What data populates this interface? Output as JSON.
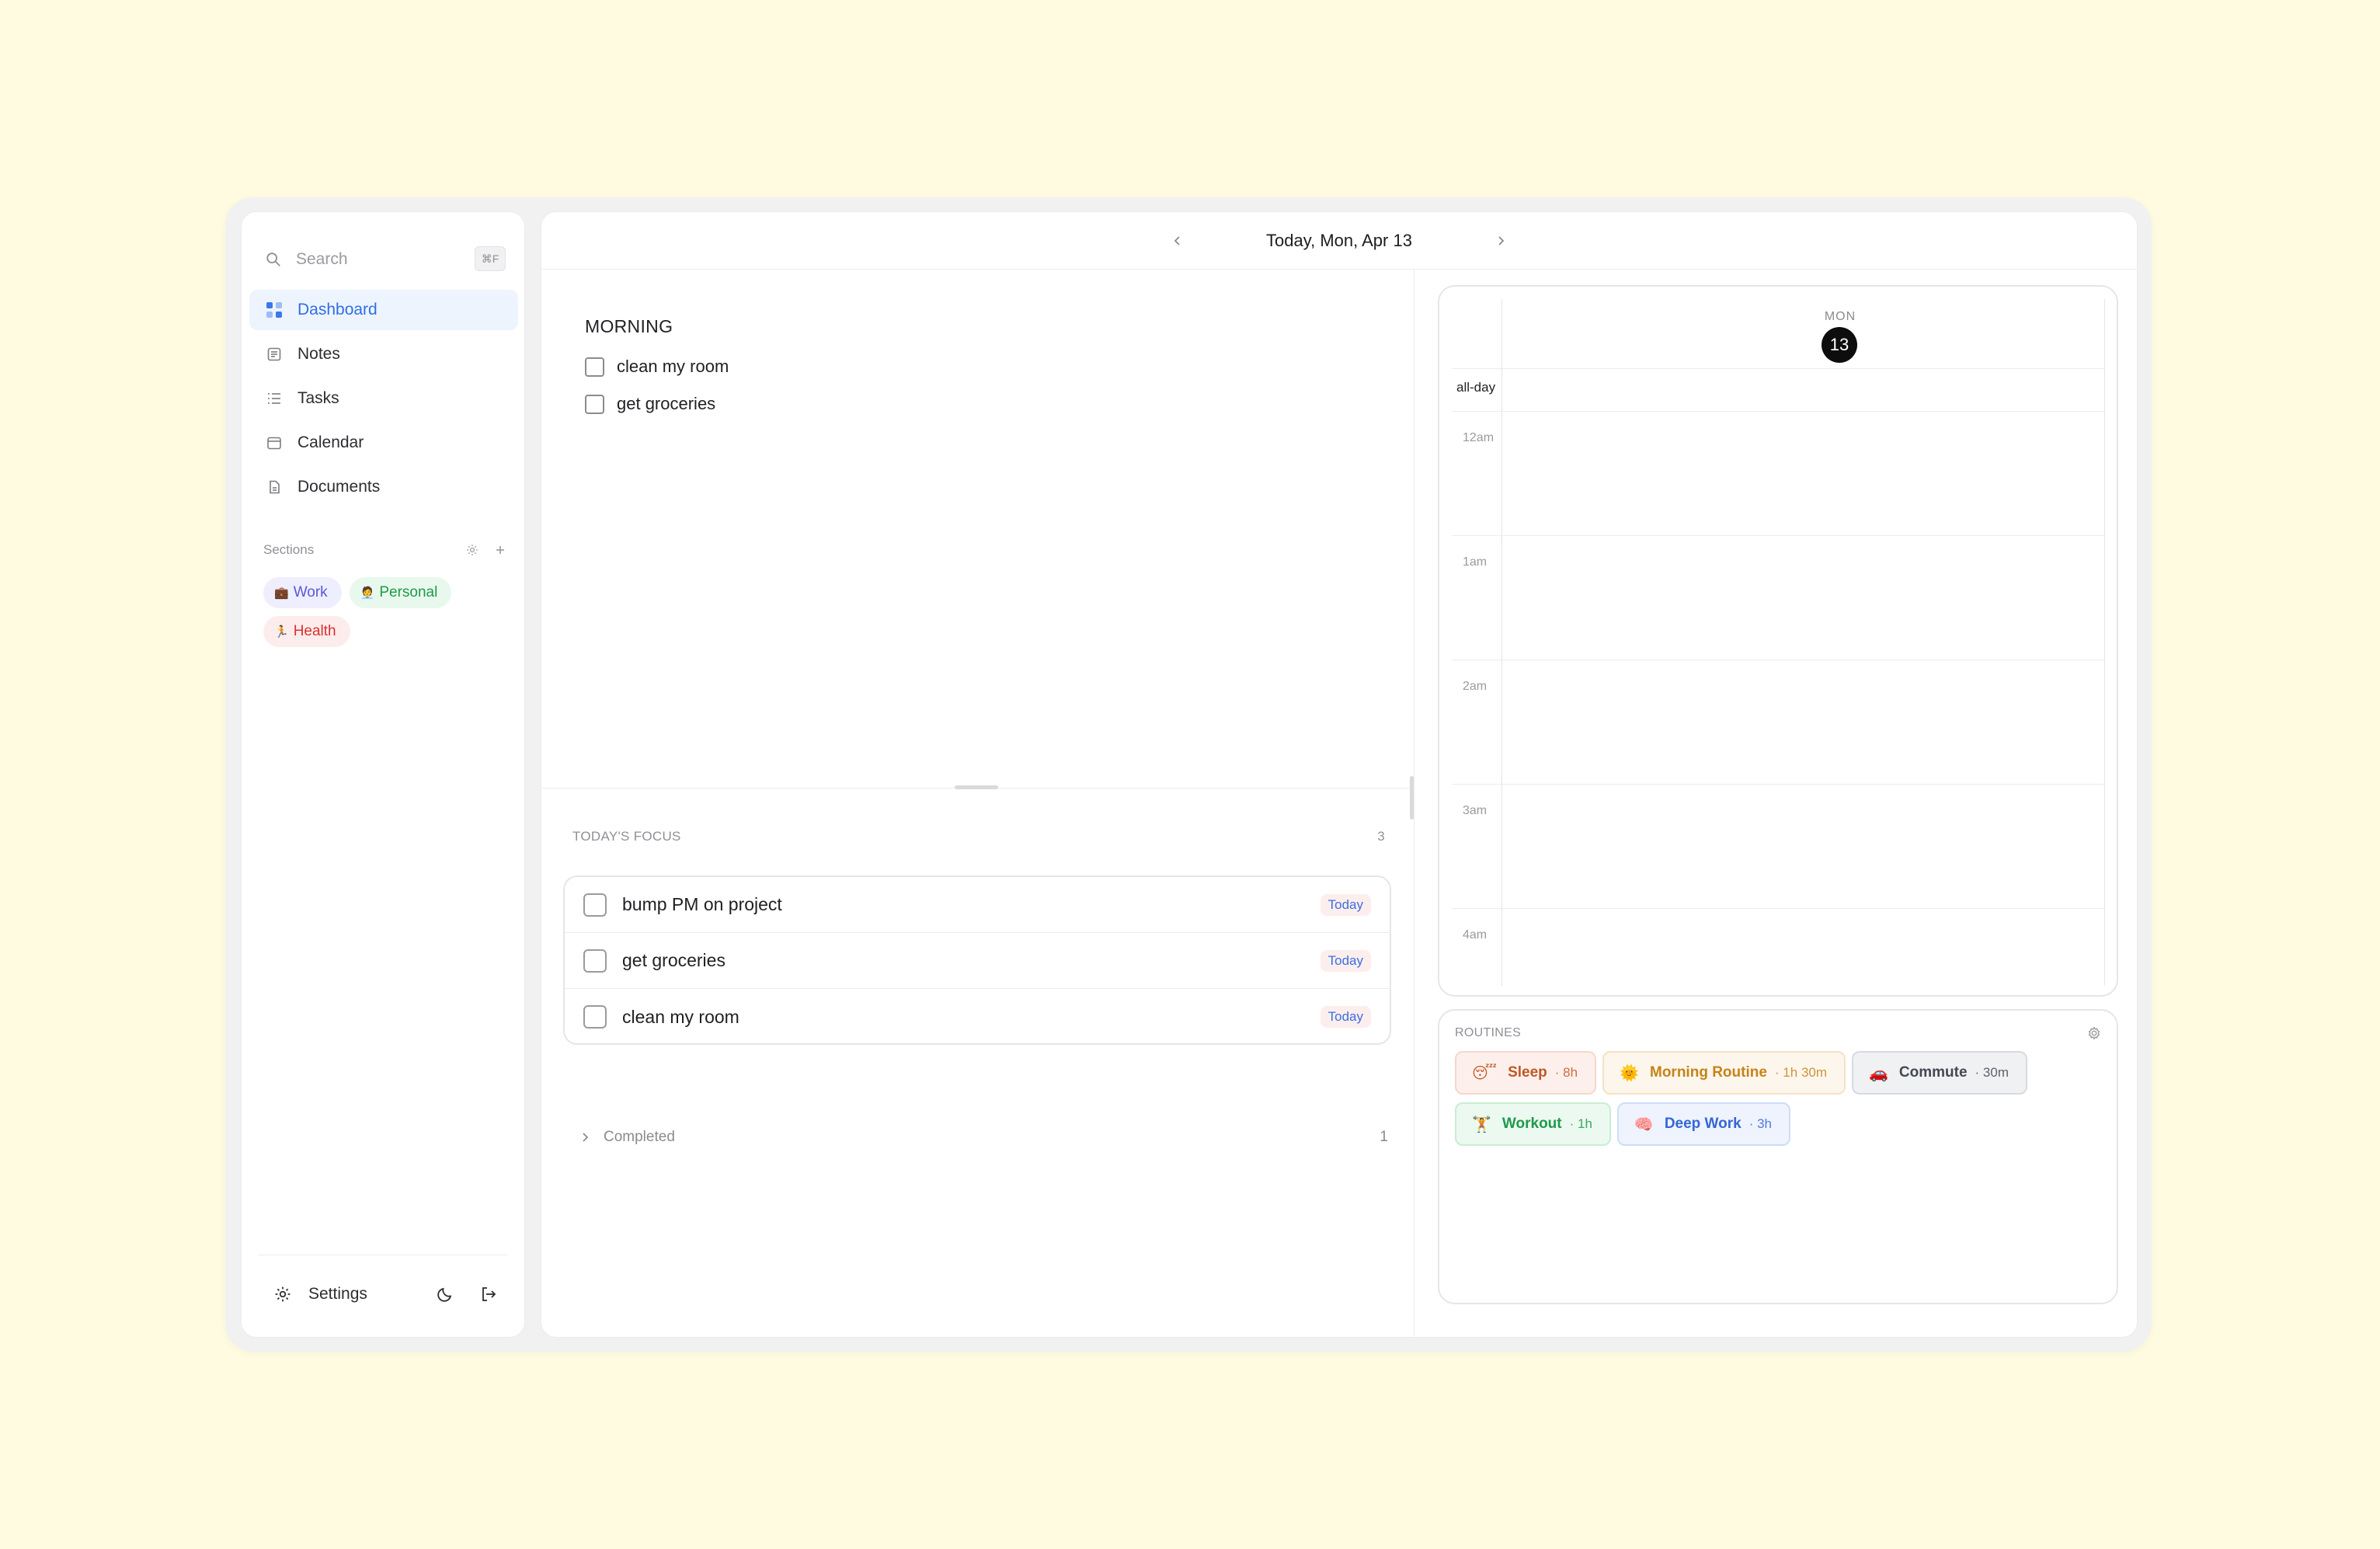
{
  "sidebar": {
    "search_placeholder": "Search",
    "search_shortcut": "⌘F",
    "nav": [
      {
        "label": "Dashboard",
        "icon": "grid-icon",
        "active": true
      },
      {
        "label": "Notes",
        "icon": "note-icon"
      },
      {
        "label": "Tasks",
        "icon": "list-icon"
      },
      {
        "label": "Calendar",
        "icon": "calendar-icon"
      },
      {
        "label": "Documents",
        "icon": "document-icon"
      }
    ],
    "sections_label": "Sections",
    "sections": [
      {
        "label": "Work",
        "emoji": "💼"
      },
      {
        "label": "Personal",
        "emoji": "🧑‍💼"
      },
      {
        "label": "Health",
        "emoji": "🏃"
      }
    ],
    "settings_label": "Settings"
  },
  "header": {
    "date_title": "Today, Mon, Apr 13"
  },
  "notes": {
    "heading": "MORNING",
    "items": [
      "clean my room",
      "get groceries"
    ]
  },
  "focus": {
    "title": "TODAY'S FOCUS",
    "count": "3",
    "items": [
      {
        "label": "bump PM on project",
        "badge": "Today"
      },
      {
        "label": "get groceries",
        "badge": "Today"
      },
      {
        "label": "clean my room",
        "badge": "Today"
      }
    ],
    "completed_label": "Completed",
    "completed_count": "1"
  },
  "calendar": {
    "day_label": "MON",
    "day_number": "13",
    "allday_label": "all-day",
    "hours": [
      "12am",
      "1am",
      "2am",
      "3am",
      "4am"
    ]
  },
  "routines": {
    "title": "ROUTINES",
    "items": [
      {
        "emoji": "😴",
        "label": "Sleep",
        "duration": "· 8h"
      },
      {
        "emoji": "🌞",
        "label": "Morning Routine",
        "duration": "· 1h 30m"
      },
      {
        "emoji": "🚗",
        "label": "Commute",
        "duration": "· 30m"
      },
      {
        "emoji": "🏋",
        "label": "Workout",
        "duration": "· 1h"
      },
      {
        "emoji": "🧠",
        "label": "Deep Work",
        "duration": "· 3h"
      }
    ]
  }
}
